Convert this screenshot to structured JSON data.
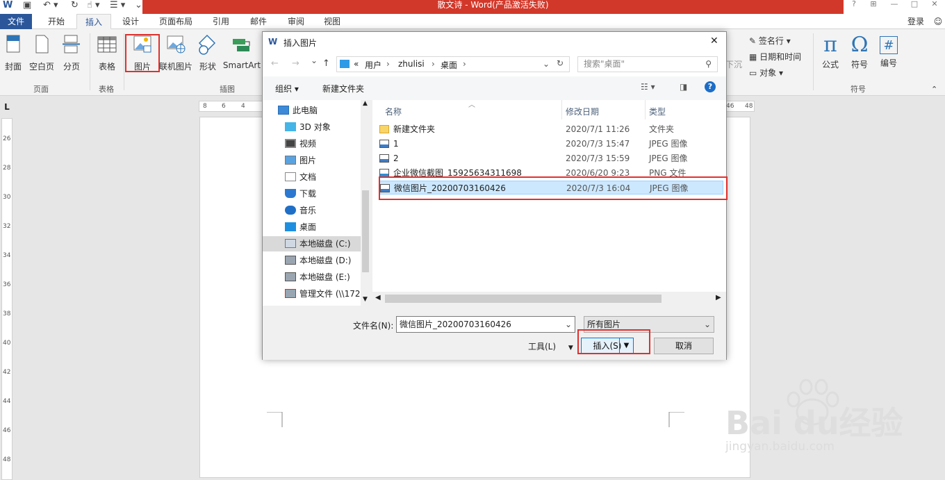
{
  "title_bar": {
    "title": "散文诗 - Word(产品激活失败)",
    "help": "?",
    "restore_ribbon": "⊞",
    "minimize": "—",
    "maximize": "□",
    "close": "✕"
  },
  "tabs": [
    "文件",
    "开始",
    "插入",
    "设计",
    "页面布局",
    "引用",
    "邮件",
    "审阅",
    "视图"
  ],
  "user": "登录",
  "ribbon": {
    "buttons": [
      {
        "label": "封面",
        "icon": "cover-page-icon"
      },
      {
        "label": "空白页",
        "icon": "blank-page-icon"
      },
      {
        "label": "分页",
        "icon": "page-break-icon"
      },
      {
        "label": "表格",
        "icon": "table-icon"
      },
      {
        "label": "图片",
        "icon": "picture-icon"
      },
      {
        "label": "联机图片",
        "icon": "online-picture-icon"
      },
      {
        "label": "形状",
        "icon": "shapes-icon"
      },
      {
        "label": "SmartArt",
        "icon": "smartart-icon"
      }
    ],
    "groups": {
      "pages": "页面",
      "tables": "表格",
      "illustrations": "插图",
      "symbols": "符号"
    },
    "right_items": {
      "signature": "签名行",
      "datetime": "日期和时间",
      "object": "对象",
      "dropcap": "下沉"
    },
    "symbol_buttons": [
      {
        "label": "公式",
        "glyph": "π"
      },
      {
        "label": "符号",
        "glyph": "Ω"
      },
      {
        "label": "编号",
        "glyph": "#"
      }
    ]
  },
  "ruler": {
    "corner": "L",
    "h_ticks_left": [
      "8",
      "6",
      "4"
    ],
    "h_ticks_right": [
      "46",
      "48"
    ],
    "v_ticks": [
      "26",
      "28",
      "30",
      "32",
      "34",
      "36",
      "38",
      "40",
      "42",
      "44",
      "46",
      "48"
    ]
  },
  "dialog": {
    "title": "插入图片",
    "close": "✕",
    "breadcrumb": [
      "«",
      "用户",
      "zhulisi",
      "桌面"
    ],
    "search_placeholder": "搜索\"桌面\"",
    "organize": "组织 ▾",
    "new_folder": "新建文件夹",
    "nav_items": [
      {
        "label": "此电脑",
        "icon": "computer-icon"
      },
      {
        "label": "3D 对象",
        "icon": "3d-objects-icon"
      },
      {
        "label": "视频",
        "icon": "video-icon"
      },
      {
        "label": "图片",
        "icon": "pictures-icon"
      },
      {
        "label": "文档",
        "icon": "documents-icon"
      },
      {
        "label": "下载",
        "icon": "download-icon"
      },
      {
        "label": "音乐",
        "icon": "music-icon"
      },
      {
        "label": "桌面",
        "icon": "desktop-icon"
      },
      {
        "label": "本地磁盘 (C:)",
        "icon": "drive-c-icon"
      },
      {
        "label": "本地磁盘 (D:)",
        "icon": "drive-icon"
      },
      {
        "label": "本地磁盘 (E:)",
        "icon": "drive-icon"
      },
      {
        "label": "管理文件 (\\\\172",
        "icon": "network-drive-icon"
      }
    ],
    "columns": {
      "name": "名称",
      "date": "修改日期",
      "type": "类型"
    },
    "files": [
      {
        "name": "新建文件夹",
        "date": "2020/7/1 11:26",
        "type": "文件夹",
        "icon": "folder-icon"
      },
      {
        "name": "1",
        "date": "2020/7/3 15:47",
        "type": "JPEG 图像",
        "icon": "image-file-icon"
      },
      {
        "name": "2",
        "date": "2020/7/3 15:59",
        "type": "JPEG 图像",
        "icon": "image-file-icon"
      },
      {
        "name": "企业微信截图_15925634311698",
        "date": "2020/6/20 9:23",
        "type": "PNG 文件",
        "icon": "png-file-icon"
      },
      {
        "name": "微信图片_20200703160426",
        "date": "2020/7/3 16:04",
        "type": "JPEG 图像",
        "icon": "image-file-icon"
      }
    ],
    "filename_label": "文件名(N):",
    "filename_value": "微信图片_20200703160426",
    "filter_value": "所有图片",
    "tools": "工具(L)",
    "insert": "插入(S)",
    "cancel": "取消"
  },
  "watermark": {
    "brand": "Bai  du经验",
    "url": "jingyan.baidu.com"
  }
}
